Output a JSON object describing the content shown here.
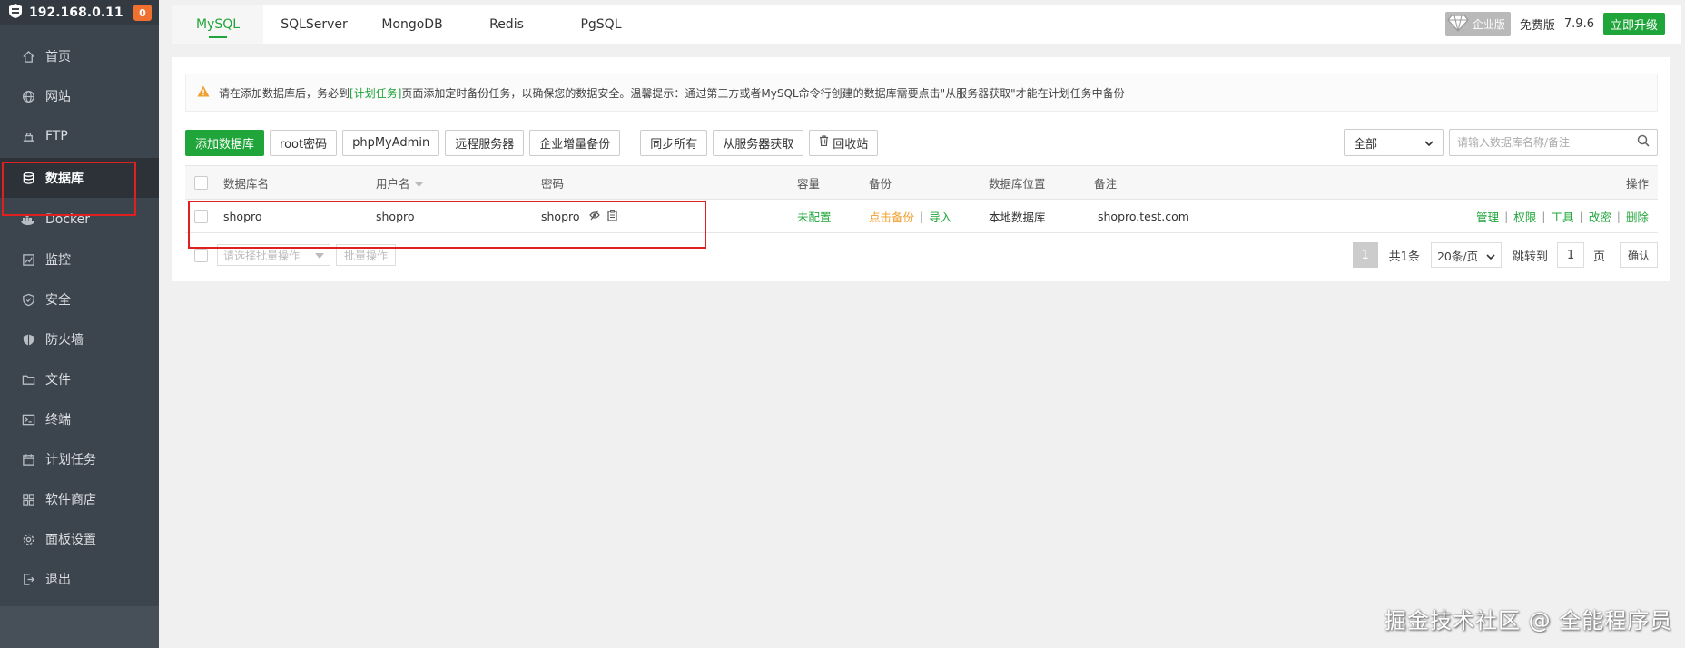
{
  "sidebar": {
    "ip": "192.168.0.11",
    "badge": "0",
    "items": [
      {
        "label": "首页",
        "icon": "home-icon"
      },
      {
        "label": "网站",
        "icon": "globe-icon"
      },
      {
        "label": "FTP",
        "icon": "ftp-icon"
      },
      {
        "label": "数据库",
        "icon": "database-icon"
      },
      {
        "label": "Docker",
        "icon": "docker-icon"
      },
      {
        "label": "监控",
        "icon": "monitor-icon"
      },
      {
        "label": "安全",
        "icon": "shield-icon"
      },
      {
        "label": "防火墙",
        "icon": "firewall-icon"
      },
      {
        "label": "文件",
        "icon": "folder-icon"
      },
      {
        "label": "终端",
        "icon": "terminal-icon"
      },
      {
        "label": "计划任务",
        "icon": "calendar-icon"
      },
      {
        "label": "软件商店",
        "icon": "apps-icon"
      },
      {
        "label": "面板设置",
        "icon": "gear-icon"
      },
      {
        "label": "退出",
        "icon": "logout-icon"
      }
    ]
  },
  "tabs": [
    "MySQL",
    "SQLServer",
    "MongoDB",
    "Redis",
    "PgSQL"
  ],
  "topright": {
    "enterprise": "企业版",
    "free": "免费版",
    "version": "7.9.6",
    "upgrade": "立即升级"
  },
  "notice": {
    "pre": "请在添加数据库后，务必到",
    "link": "[计划任务]",
    "post": "页面添加定时备份任务，以确保您的数据安全。温馨提示：通过第三方或者MySQL命令行创建的数据库需要点击\"从服务器获取\"才能在计划任务中备份"
  },
  "toolbar": {
    "add": "添加数据库",
    "root": "root密码",
    "pma": "phpMyAdmin",
    "remote": "远程服务器",
    "enterprise_backup": "企业增量备份",
    "sync": "同步所有",
    "fetch": "从服务器获取",
    "recycle": "回收站",
    "filter": "全部",
    "search_placeholder": "请输入数据库名称/备注"
  },
  "table": {
    "headers": {
      "name": "数据库名",
      "user": "用户名",
      "password": "密码",
      "capacity": "容量",
      "backup": "备份",
      "location": "数据库位置",
      "remark": "备注",
      "ops": "操作"
    },
    "rows": [
      {
        "name": "shopro",
        "user": "shopro",
        "password": "shopro",
        "capacity": "未配置",
        "backup": "点击备份",
        "import": "导入",
        "location": "本地数据库",
        "remark": "shopro.test.com",
        "ops": [
          "管理",
          "权限",
          "工具",
          "改密",
          "删除"
        ]
      }
    ]
  },
  "footer": {
    "batch_select": "请选择批量操作",
    "batch_button": "批量操作",
    "page": "1",
    "total": "共1条",
    "page_size": "20条/页",
    "jump": "跳转到",
    "jump_value": "1",
    "page_unit": "页",
    "confirm": "确认"
  },
  "watermark": "掘金技术社区 @ 全能程序员",
  "colors": {
    "accent": "#20a53a",
    "sidebar_bg": "#3c444d",
    "highlight_box": "#e0201e",
    "badge": "#f0712f"
  }
}
